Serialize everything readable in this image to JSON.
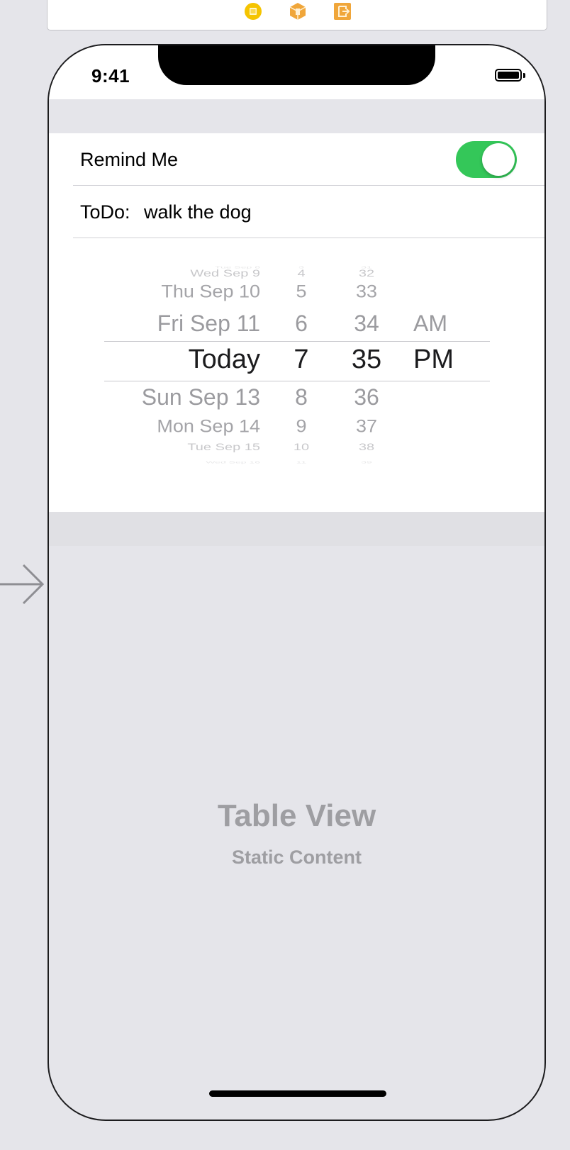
{
  "scene_bar": {
    "icons": [
      {
        "name": "view-controller-icon",
        "color": "#f5c400"
      },
      {
        "name": "first-responder-icon",
        "color": "#f0a63a"
      },
      {
        "name": "exit-icon",
        "color": "#f0a63a"
      }
    ]
  },
  "status_bar": {
    "time": "9:41"
  },
  "cells": {
    "remind_me": {
      "label": "Remind Me",
      "toggle_on": true
    },
    "todo": {
      "label": "ToDo:",
      "value": "walk the dog"
    }
  },
  "date_picker": {
    "columns": {
      "date": [
        "Tue Sep 8",
        "Wed Sep 9",
        "Thu Sep 10",
        "Fri Sep 11",
        "Today",
        "Sun Sep 13",
        "Mon Sep 14",
        "Tue Sep 15",
        "Wed Sep 16"
      ],
      "hour": [
        "3",
        "4",
        "5",
        "6",
        "7",
        "8",
        "9",
        "10",
        "11"
      ],
      "minute": [
        "31",
        "32",
        "33",
        "34",
        "35",
        "36",
        "37",
        "38",
        "39"
      ],
      "ampm": [
        "",
        "",
        "",
        "AM",
        "PM",
        "",
        "",
        "",
        ""
      ]
    },
    "selected_index": 4
  },
  "table_placeholder": {
    "title": "Table View",
    "subtitle": "Static Content"
  },
  "colors": {
    "toggle_on": "#34c759",
    "canvas": "#e5e5ea"
  }
}
